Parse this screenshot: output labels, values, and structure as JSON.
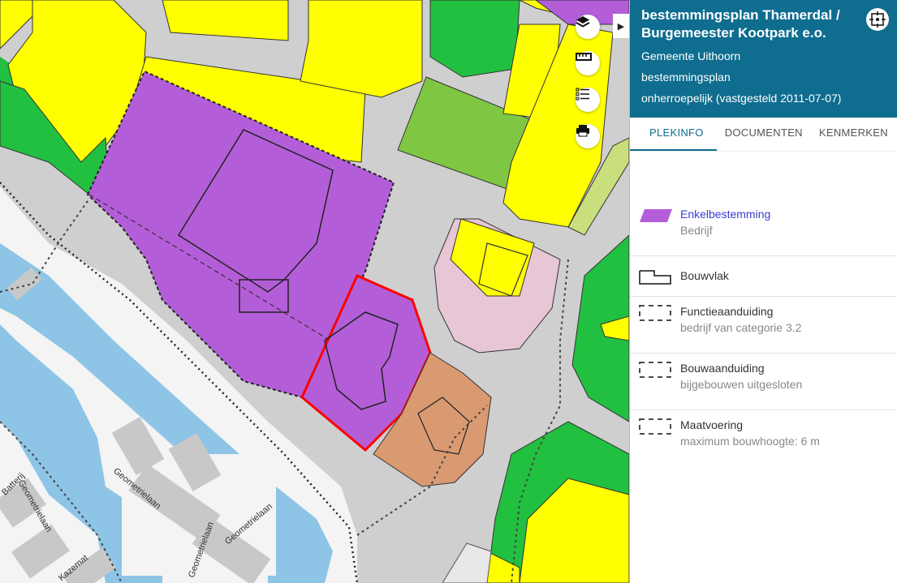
{
  "plan": {
    "title": "bestemmingsplan Thamerdal / Burgemeester Kootpark e.o.",
    "gemeente": "Gemeente Uithoorn",
    "type": "bestemmingsplan",
    "status": "onherroepelijk (vastgesteld 2011-07-07)"
  },
  "tabs": [
    {
      "label": "PLEKINFO",
      "active": true
    },
    {
      "label": "DOCUMENTEN",
      "active": false
    },
    {
      "label": "KENMERKEN",
      "active": false
    }
  ],
  "legend": [
    {
      "title": "Enkelbestemming",
      "sub": "Bedrijf",
      "swatch": "purple-parallelogram",
      "color": "#b35ed8"
    },
    {
      "title": "Bouwvlak",
      "sub": "",
      "swatch": "outline-shape"
    },
    {
      "title": "Functieaanduiding",
      "sub": "bedrijf van categorie 3.2",
      "swatch": "dashed-box"
    },
    {
      "title": "Bouwaanduiding",
      "sub": "bijgebouwen uitgesloten",
      "swatch": "dashed-box"
    },
    {
      "title": "Maatvoering",
      "sub": "maximum bouwhoogte: 6 m",
      "swatch": "dashed-box"
    }
  ],
  "map": {
    "street_labels": [
      "Geometrielaan",
      "Geometrielaan",
      "Geometrielaan",
      "Geometrielaan",
      "Kazemat",
      "Batterij"
    ],
    "controls": [
      "layers-icon",
      "ruler-icon",
      "legend-list-icon",
      "print-icon"
    ],
    "colors": {
      "wonen": "#ffff00",
      "bedrijf": "#b35ed8",
      "groen": "#22c040",
      "sport": "#7fc743",
      "maatschappelijk": "#e7c6d6",
      "horeca": "#d99a72",
      "water": "#8ec4e6",
      "road": "#cfcfcf",
      "selection": "#ff0000"
    }
  }
}
